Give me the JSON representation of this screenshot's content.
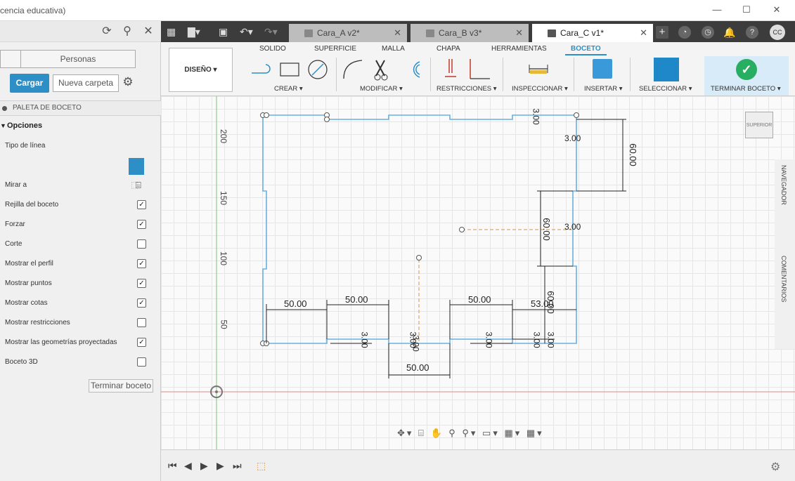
{
  "window": {
    "title": "cencia educativa)",
    "minimize": "—",
    "maximize": "☐",
    "close": "✕"
  },
  "left_panel": {
    "tab_people": "Personas",
    "load_button": "Cargar",
    "new_folder_button": "Nueva carpeta",
    "palette_title": "PALETA DE BOCETO",
    "options_label": "Opciones",
    "options": [
      {
        "label": "Tipo de línea",
        "checked": null
      },
      {
        "label": "Mirar a",
        "checked": null
      },
      {
        "label": "Rejilla del boceto",
        "checked": true
      },
      {
        "label": "Forzar",
        "checked": true
      },
      {
        "label": "Corte",
        "checked": false
      },
      {
        "label": "Mostrar el perfil",
        "checked": true
      },
      {
        "label": "Mostrar puntos",
        "checked": true
      },
      {
        "label": "Mostrar cotas",
        "checked": true
      },
      {
        "label": "Mostrar restricciones",
        "checked": false
      },
      {
        "label": "Mostrar las geometrías proyectadas",
        "checked": true
      },
      {
        "label": "Boceto 3D",
        "checked": false
      }
    ],
    "finish_sketch": "Terminar boceto"
  },
  "tabs": [
    {
      "label": "Cara_A v2*",
      "active": false
    },
    {
      "label": "Cara_B v3*",
      "active": false
    },
    {
      "label": "Cara_C v1*",
      "active": true
    }
  ],
  "user_initials": "CC",
  "toolbar": {
    "design_menu": "DISEÑO ▾",
    "modes": [
      "SOLIDO",
      "SUPERFICIE",
      "MALLA",
      "CHAPA",
      "HERRAMIENTAS",
      "BOCETO"
    ],
    "active_mode": "BOCETO",
    "groups": [
      "CREAR ▾",
      "MODIFICAR ▾",
      "RESTRICCIONES ▾",
      "INSPECCIONAR ▾",
      "INSERTAR ▾",
      "SELECCIONAR ▾",
      "TERMINAR BOCETO ▾"
    ]
  },
  "canvas": {
    "ruler_labels": [
      "200",
      "150",
      "100",
      "50"
    ],
    "dimensions": [
      "50.00",
      "50.00",
      "50.00",
      "53.00",
      "50.00",
      "60.00",
      "60.00",
      "60.00",
      "3.00",
      "3.00",
      "3.00",
      "3.00",
      "3.00",
      "3.00",
      "3.00",
      "3.00",
      "3.00"
    ],
    "viewcube_label": "SUPERIOR",
    "nav_label": "NAVEGADOR",
    "comments_label": "COMENTARIOS"
  }
}
